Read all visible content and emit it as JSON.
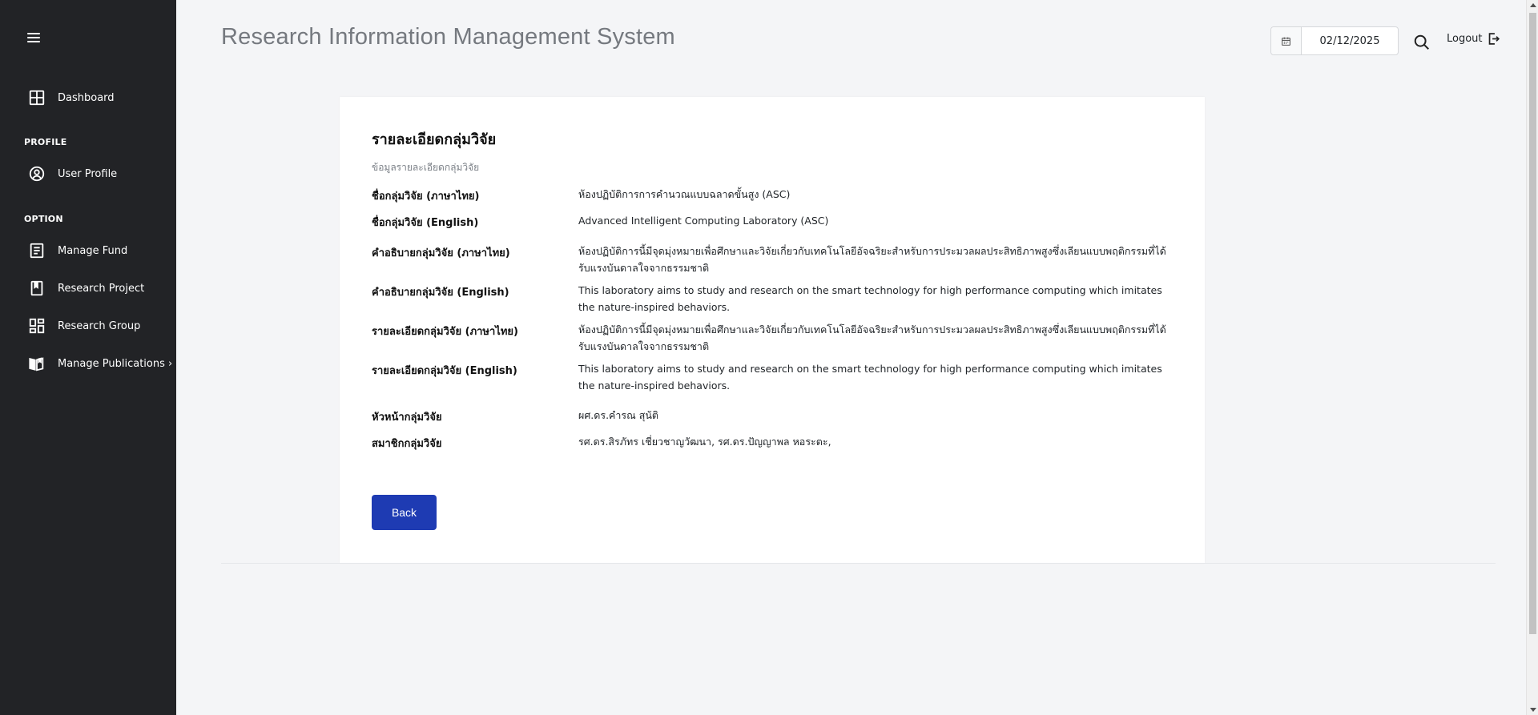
{
  "app": {
    "title": "Research Information Management System"
  },
  "header": {
    "date_value": "02/12/2025",
    "logout_label": "Logout"
  },
  "sidebar": {
    "dashboard_label": "Dashboard",
    "profile_section": "PROFILE",
    "user_profile_label": "User Profile",
    "option_section": "OPTION",
    "manage_fund_label": "Manage Fund",
    "research_project_label": "Research Project",
    "research_group_label": "Research Group",
    "manage_publications_label": "Manage Publications ›"
  },
  "card": {
    "title": "รายละเอียดกลุ่มวิจัย",
    "subtitle": "ข้อมูลรายละเอียดกลุ่มวิจัย",
    "rows": [
      {
        "label": "ชื่อกลุ่มวิจัย (ภาษาไทย)",
        "value": "ห้องปฏิบัติการการคำนวณแบบฉลาดขั้นสูง (ASC)"
      },
      {
        "label": "ชื่อกลุ่มวิจัย (English)",
        "value": "Advanced Intelligent Computing Laboratory (ASC)"
      },
      {
        "label": "คำอธิบายกลุ่มวิจัย (ภาษาไทย)",
        "value": "ห้องปฏิบัติการนี้มีจุดมุ่งหมายเพื่อศึกษาและวิจัยเกี่ยวกับเทคโนโลยีอัจฉริยะสำหรับการประมวลผลประสิทธิภาพสูงซึ่งเลียนแบบพฤติกรรมที่ได้รับแรงบันดาลใจจากธรรมชาติ"
      },
      {
        "label": "คำอธิบายกลุ่มวิจัย (English)",
        "value": "This laboratory aims to study and research on the smart technology for high performance computing which imitates the nature-inspired behaviors."
      },
      {
        "label": "รายละเอียดกลุ่มวิจัย (ภาษาไทย)",
        "value": "ห้องปฏิบัติการนี้มีจุดมุ่งหมายเพื่อศึกษาและวิจัยเกี่ยวกับเทคโนโลยีอัจฉริยะสำหรับการประมวลผลประสิทธิภาพสูงซึ่งเลียนแบบพฤติกรรมที่ได้รับแรงบันดาลใจจากธรรมชาติ"
      },
      {
        "label": "รายละเอียดกลุ่มวิจัย (English)",
        "value": "This laboratory aims to study and research on the smart technology for high performance computing which imitates the nature-inspired behaviors."
      },
      {
        "label": "หัวหน้ากลุ่มวิจัย",
        "value": "ผศ.ดร.คำรณ สุนัติ"
      },
      {
        "label": "สมาชิกกลุ่มวิจัย",
        "value": "รศ.ดร.สิรภัทร เชี่ยวชาญวัฒนา, รศ.ดร.ปัญญาพล หอระตะ,"
      }
    ],
    "back_label": "Back"
  },
  "colors": {
    "sidebar_bg": "#222326",
    "page_bg": "#f4f5f7",
    "accent": "#1e3bb3"
  },
  "icons": {
    "menu": "hamburger-icon",
    "dashboard": "grid-icon",
    "user_profile": "user-circle-icon",
    "manage_fund": "document-list-icon",
    "research_project": "bookmark-book-icon",
    "research_group": "group-grid-icon",
    "manage_publications": "open-book-icon",
    "date": "calendar-icon",
    "search": "search-icon",
    "logout": "logout-icon"
  }
}
